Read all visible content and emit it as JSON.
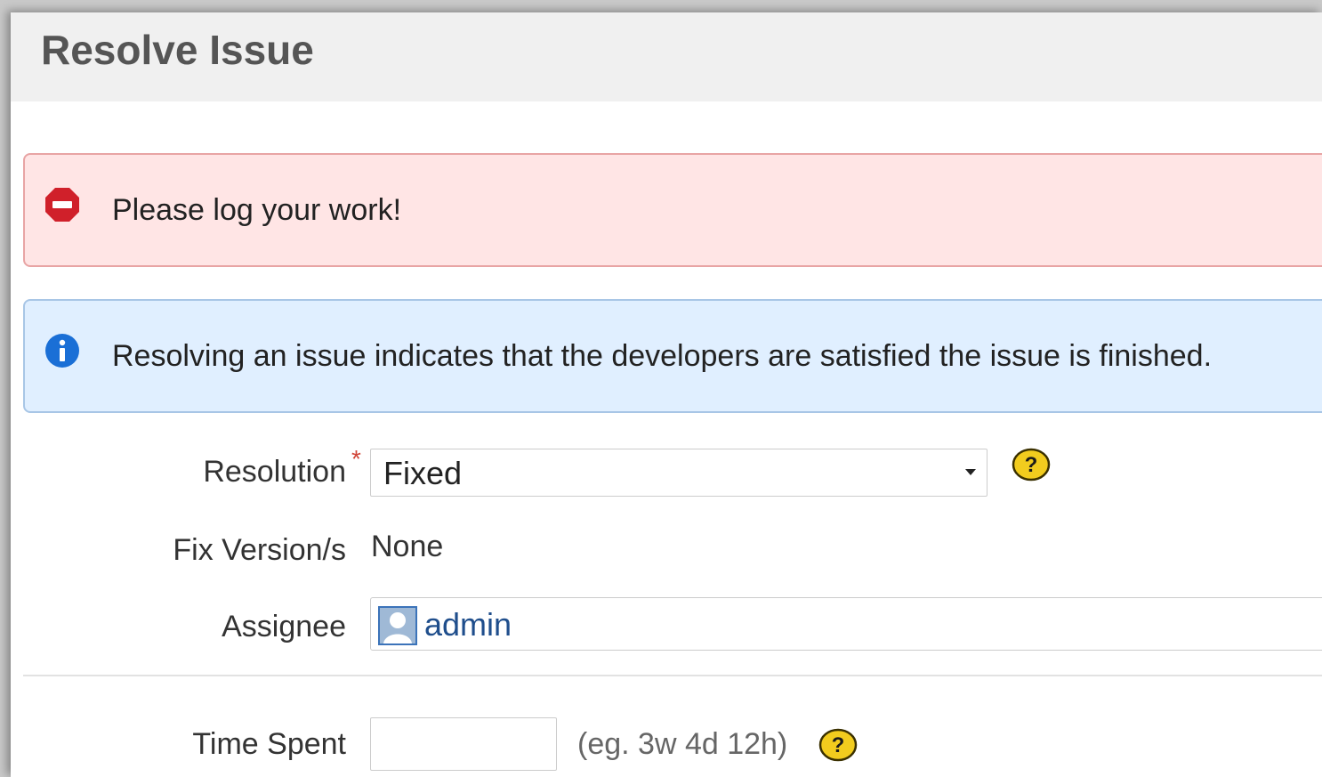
{
  "dialog": {
    "title": "Resolve Issue"
  },
  "messages": {
    "error": {
      "icon": "error-stop-icon",
      "text": "Please log your work!",
      "color": "#d0202a"
    },
    "info": {
      "icon": "info-icon",
      "text": "Resolving an issue indicates that the developers are satisfied the issue is finished.",
      "color": "#1a6fd6"
    }
  },
  "form": {
    "resolution": {
      "label": "Resolution",
      "required_marker": "*",
      "selected_value": "Fixed",
      "help_icon": "help-icon"
    },
    "fix_versions": {
      "label": "Fix Version/s",
      "value": "None"
    },
    "assignee": {
      "label": "Assignee",
      "avatar_icon": "user-avatar-icon",
      "value": "admin"
    },
    "time_spent": {
      "label": "Time Spent",
      "value": "",
      "hint": "(eg. 3w 4d 12h)",
      "help_icon": "help-icon"
    }
  }
}
